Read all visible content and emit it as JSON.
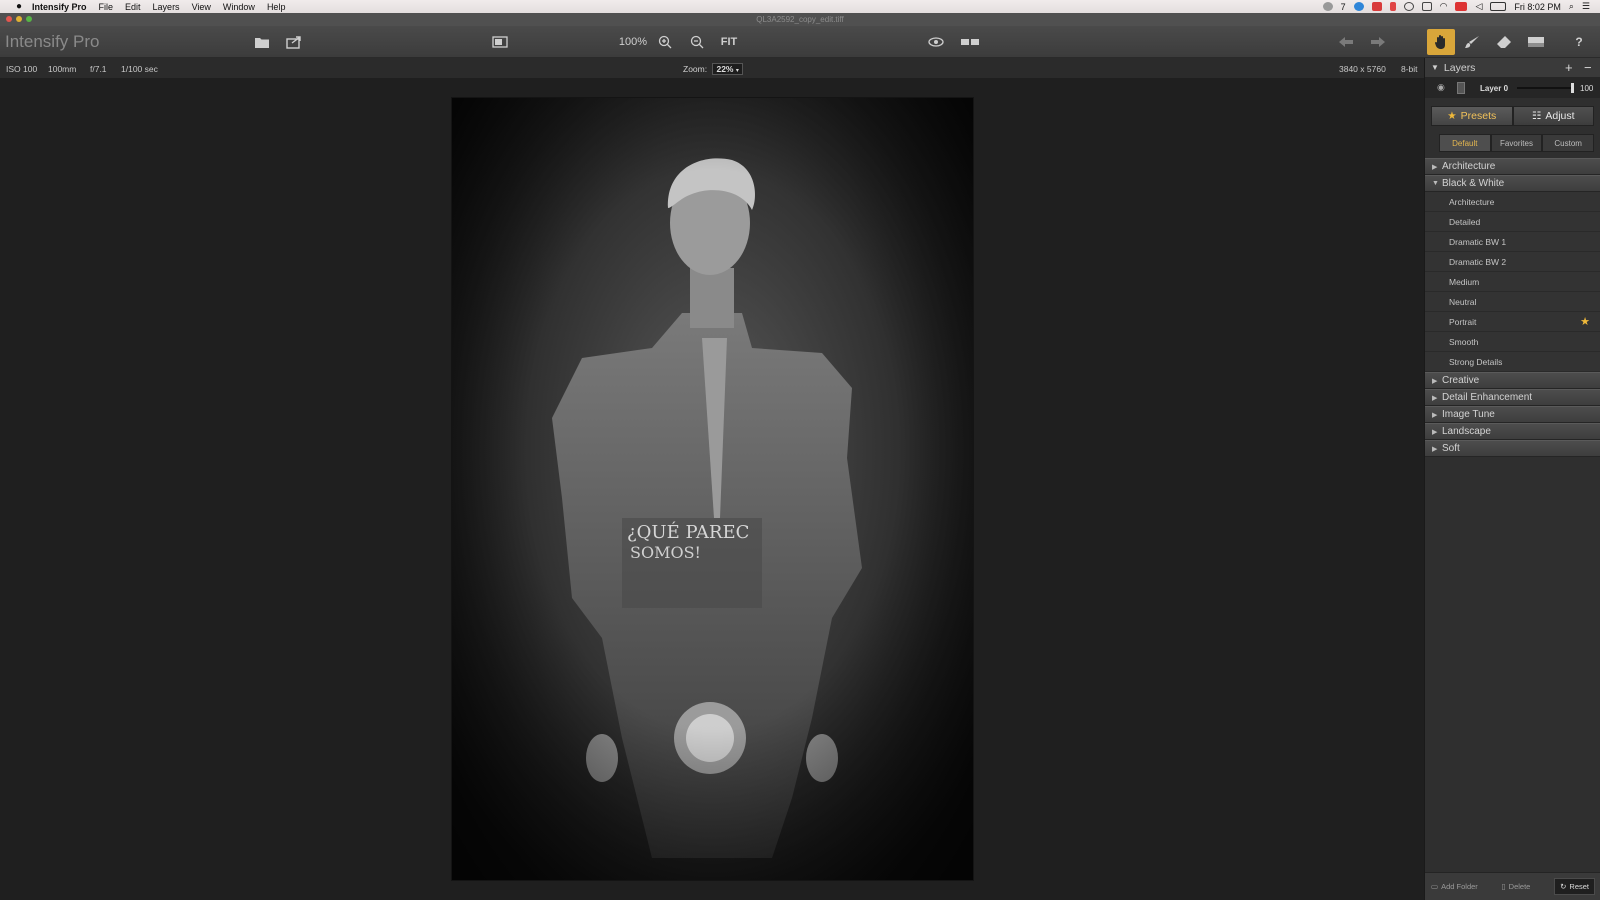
{
  "menubar": {
    "app_name": "Intensify Pro",
    "items": [
      "File",
      "Edit",
      "Layers",
      "View",
      "Window",
      "Help"
    ],
    "status_text": "7",
    "clock": "Fri 8:02 PM"
  },
  "window": {
    "file_title": "QL3A2592_copy_edit.tiff"
  },
  "toolbar": {
    "app_title": "Intensify Pro",
    "zoom_100": "100%",
    "fit": "FIT",
    "help": "?"
  },
  "infobar": {
    "iso": "ISO 100",
    "focal": "100mm",
    "aperture": "f/7.1",
    "shutter": "1/100 sec",
    "zoom_label": "Zoom:",
    "zoom_value": "22%",
    "dimensions": "3840 x 5760",
    "bitdepth": "8-bit"
  },
  "panel": {
    "layers_title": "Layers",
    "add": "+",
    "remove": "−",
    "layer_name": "Layer 0",
    "layer_opacity": "100",
    "mode_tabs": [
      "Presets",
      "Adjust"
    ],
    "sub_tabs": [
      "Default",
      "Favorites",
      "Custom"
    ],
    "groups": {
      "architecture": "Architecture",
      "bw": "Black & White",
      "creative": "Creative",
      "detail": "Detail Enhancement",
      "imagetune": "Image Tune",
      "landscape": "Landscape",
      "soft": "Soft"
    },
    "bw_presets": [
      "Architecture",
      "Detailed",
      "Dramatic BW 1",
      "Dramatic BW 2",
      "Medium",
      "Neutral",
      "Portrait",
      "Smooth",
      "Strong Details"
    ],
    "footer": {
      "add_folder": "Add Folder",
      "delete": "Delete",
      "reset": "Reset"
    }
  },
  "colors": {
    "accent": "#f0b93a",
    "panel_bg": "#2f2f2f",
    "canvas_bg": "#1f1f1f"
  }
}
